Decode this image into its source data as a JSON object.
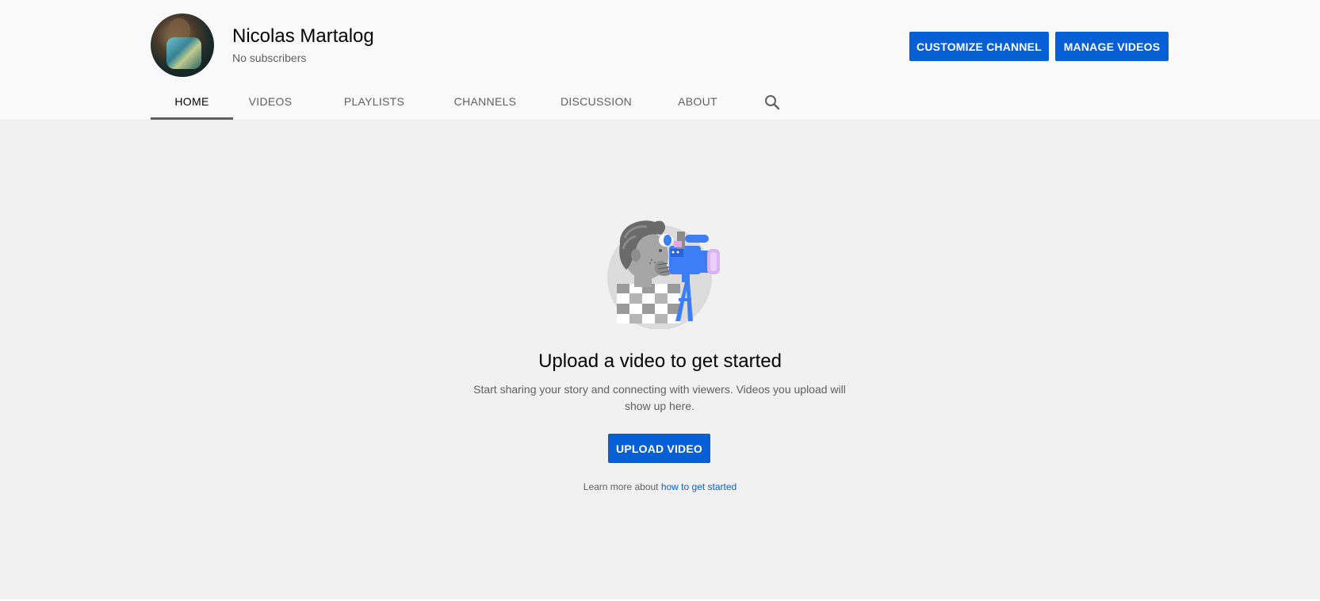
{
  "channel": {
    "name": "Nicolas Martalog",
    "subscribers": "No subscribers"
  },
  "header_actions": {
    "customize_label": "CUSTOMIZE CHANNEL",
    "manage_label": "MANAGE VIDEOS"
  },
  "tabs": [
    {
      "label": "HOME",
      "active": true
    },
    {
      "label": "VIDEOS",
      "active": false
    },
    {
      "label": "PLAYLISTS",
      "active": false
    },
    {
      "label": "CHANNELS",
      "active": false
    },
    {
      "label": "DISCUSSION",
      "active": false
    },
    {
      "label": "ABOUT",
      "active": false
    }
  ],
  "search_icon": "search-icon",
  "empty_state": {
    "title": "Upload a video to get started",
    "description": "Start sharing your story and connecting with viewers. Videos you upload will show up here.",
    "upload_label": "UPLOAD VIDEO",
    "learn_prefix": "Learn more about ",
    "learn_link": "how to get started"
  },
  "colors": {
    "accent": "#065fd4",
    "header_bg": "#f9f9f9",
    "page_bg": "#f1f1f1"
  }
}
